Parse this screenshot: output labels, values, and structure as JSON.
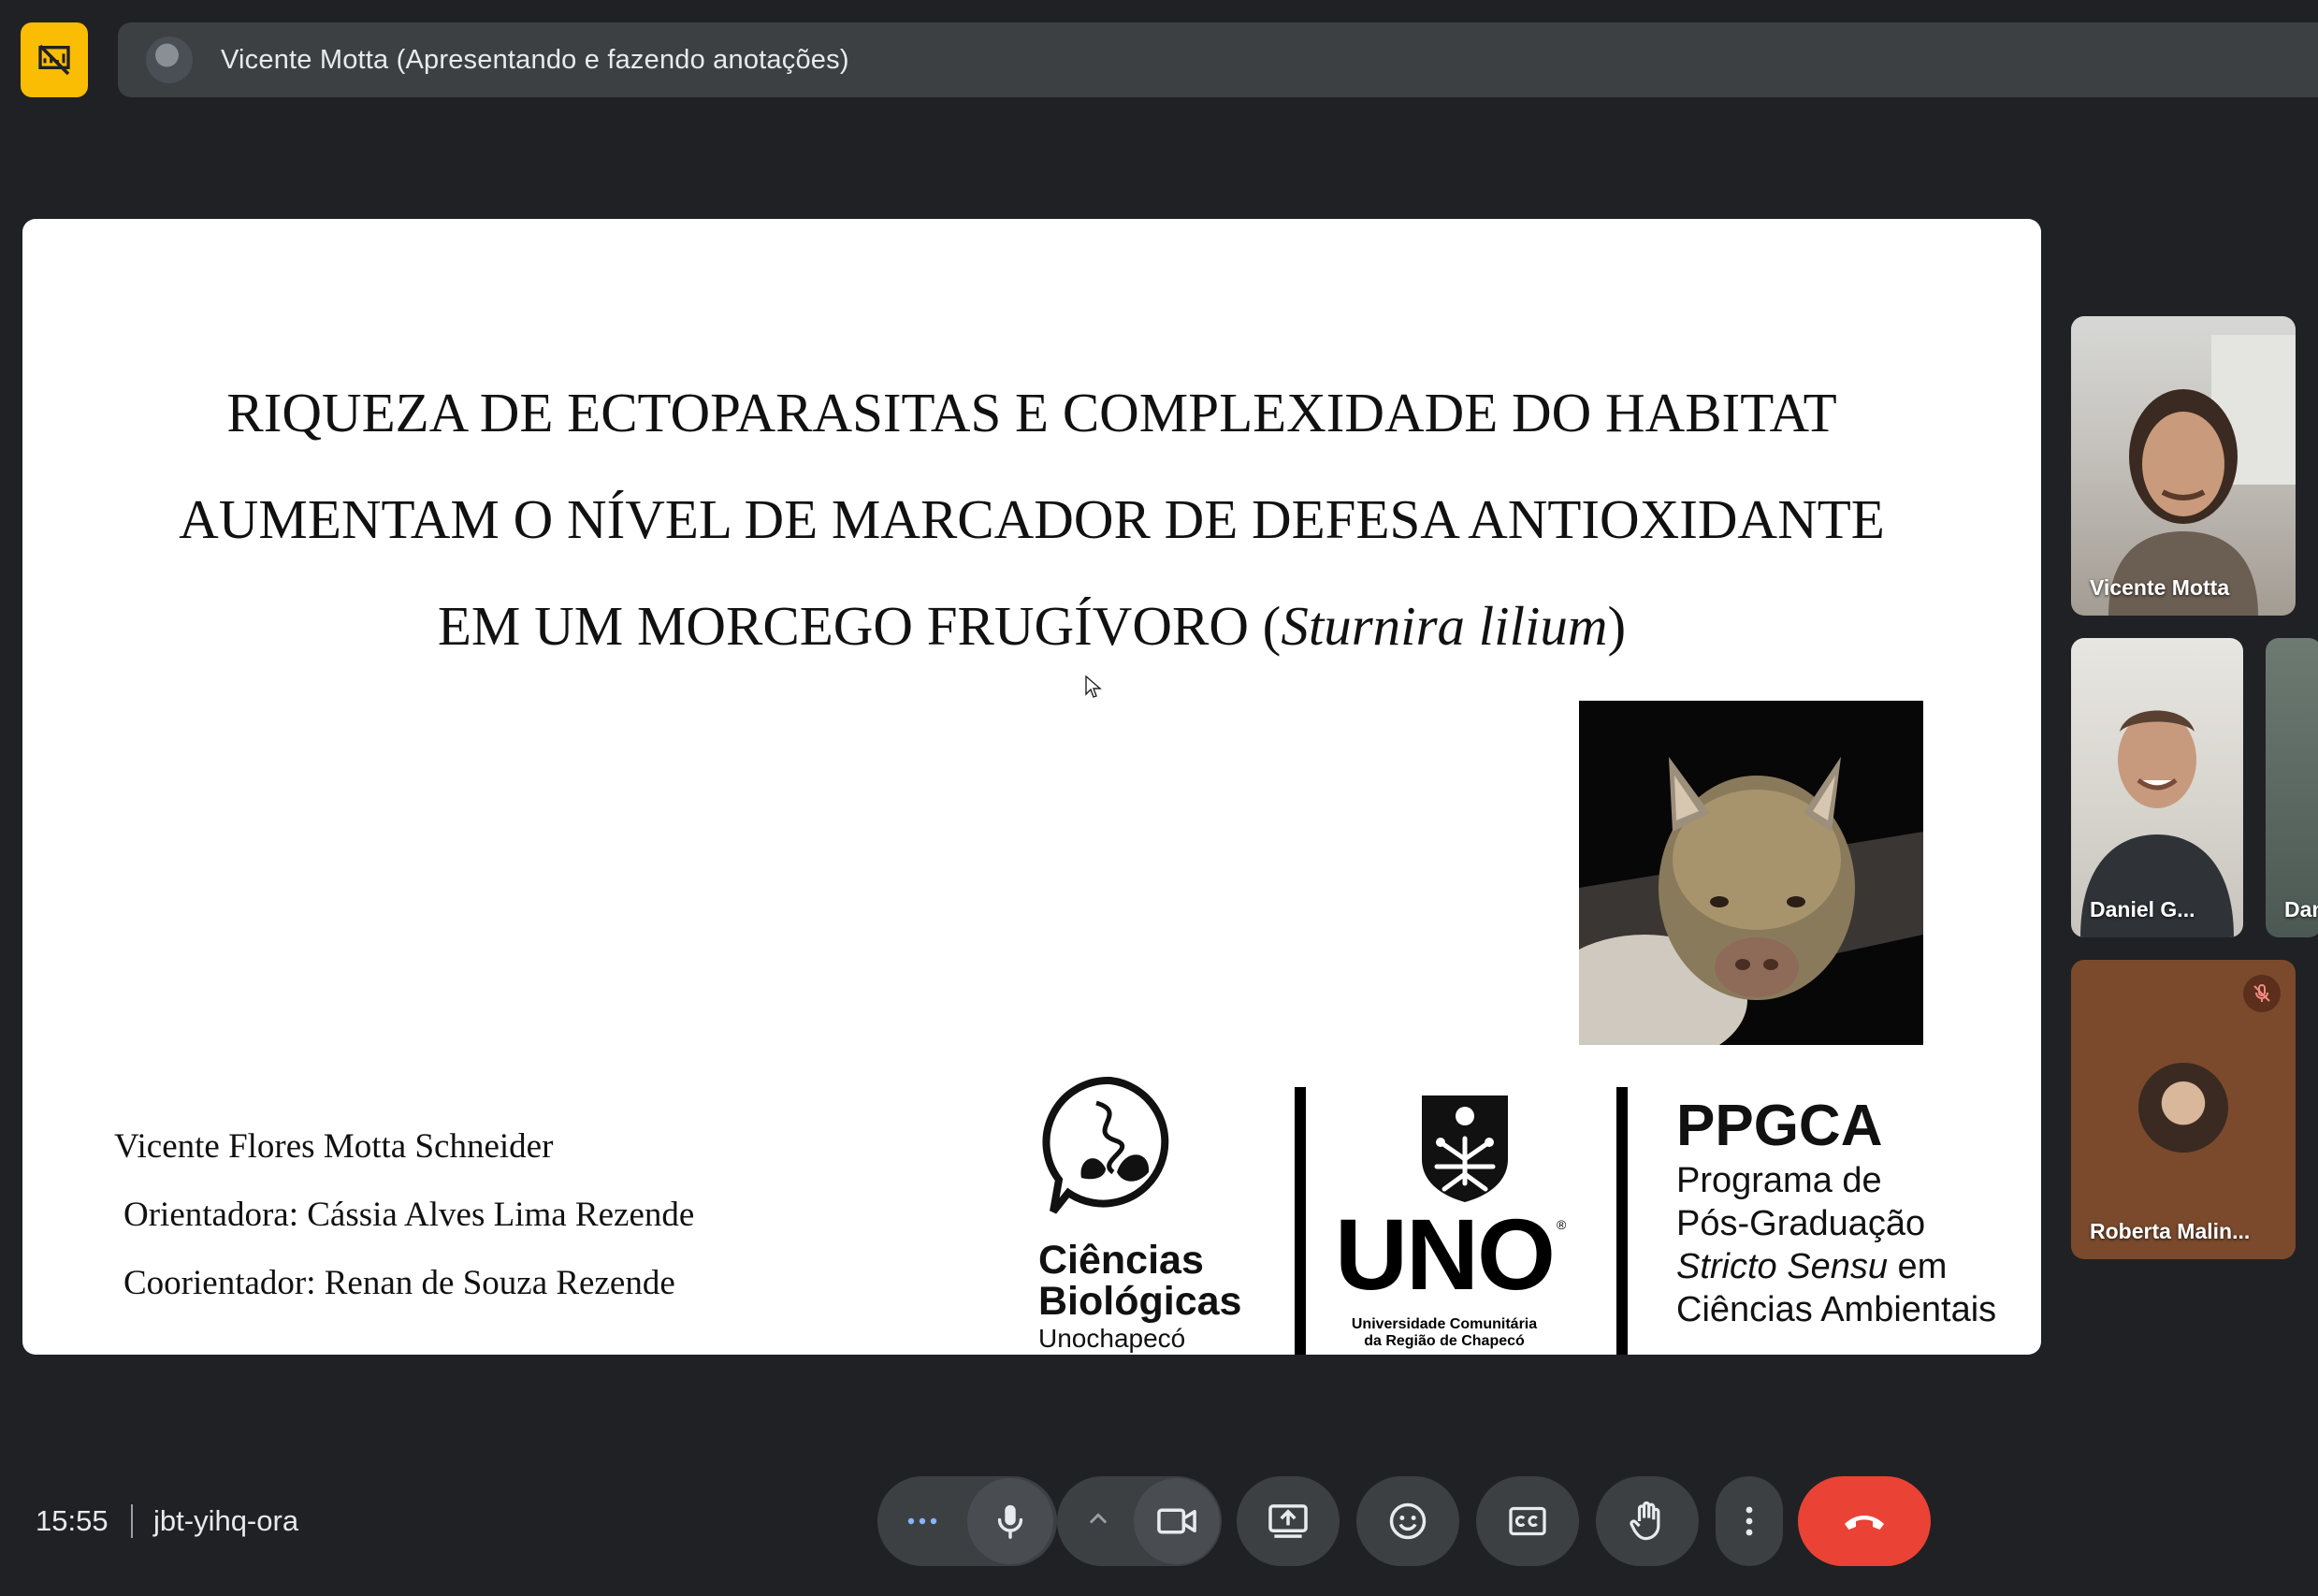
{
  "presenter": {
    "label": "Vicente Motta (Apresentando e fazendo anotações)"
  },
  "slide": {
    "title_line1": "RIQUEZA DE ECTOPARASITAS E COMPLEXIDADE DO HABITAT",
    "title_line2": "AUMENTAM O NÍVEL DE MARCADOR DE DEFESA ANTIOXIDANTE",
    "title_line3_prefix": "EM UM MORCEGO FRUGÍVORO (",
    "title_line3_species": "Sturnira lilium",
    "title_line3_suffix": ")",
    "author": "Vicente Flores Motta Schneider",
    "advisor": "Orientadora: Cássia Alves Lima Rezende",
    "coadvisor": "Coorientador: Renan de Souza Rezende",
    "logo_cb": {
      "line1": "Ciências",
      "line2": "Biológicas",
      "line3": "Unochapecó"
    },
    "logo_uno": {
      "word": "UNO",
      "reg": "®",
      "sub1": "Universidade Comunitária",
      "sub2": "da Região de Chapecó"
    },
    "logo_ppgca": {
      "head": "PPGCA",
      "line1": "Programa de",
      "line2": "Pós-Graduação",
      "line3_italic": "Stricto Sensu",
      "line3_rest": " em",
      "line4": "Ciências Ambientais"
    }
  },
  "participants": [
    {
      "name": "Vicente Motta"
    },
    {
      "name": "Daniel G..."
    },
    {
      "name": "Dan"
    },
    {
      "name": "Roberta Malin..."
    }
  ],
  "footer": {
    "time": "15:55",
    "meeting_code": "jbt-yihq-ora"
  },
  "colors": {
    "background": "#202124",
    "bar": "#3c4043",
    "badge": "#fbbc04",
    "hangup": "#ea4335"
  }
}
